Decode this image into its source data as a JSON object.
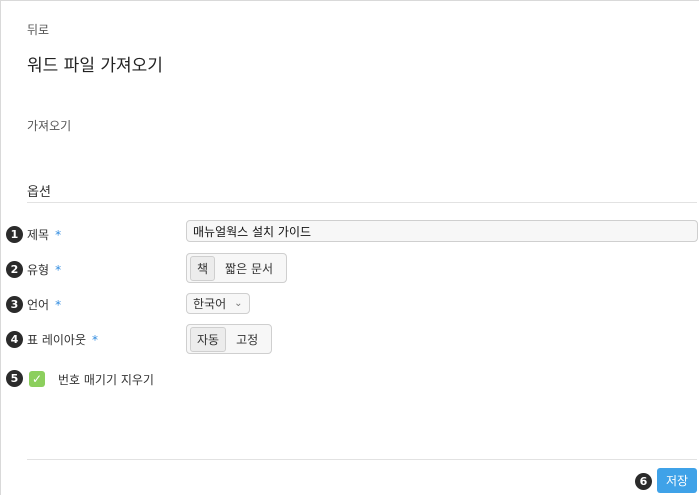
{
  "nav": {
    "back_label": "뒤로"
  },
  "page": {
    "title": "워드 파일 가져오기",
    "import_label": "가져오기"
  },
  "options": {
    "section_title": "옵션",
    "required_mark": "*",
    "title_field": {
      "badge": "1",
      "label": "제목",
      "value": "매뉴얼웍스 설치 가이드"
    },
    "type_field": {
      "badge": "2",
      "label": "유형",
      "options": [
        "책",
        "짧은 문서"
      ],
      "selected": "책"
    },
    "language_field": {
      "badge": "3",
      "label": "언어",
      "value": "한국어"
    },
    "table_layout_field": {
      "badge": "4",
      "label": "표 레이아웃",
      "options": [
        "자동",
        "고정"
      ],
      "selected": "자동"
    },
    "clear_numbering": {
      "badge": "5",
      "label": "번호 매기기 지우기",
      "checked": true
    }
  },
  "footer": {
    "badge": "6",
    "save_label": "저장"
  },
  "colors": {
    "accent": "#3fa2e8",
    "checkbox": "#8ccf5d",
    "required": "#2f8be0"
  }
}
